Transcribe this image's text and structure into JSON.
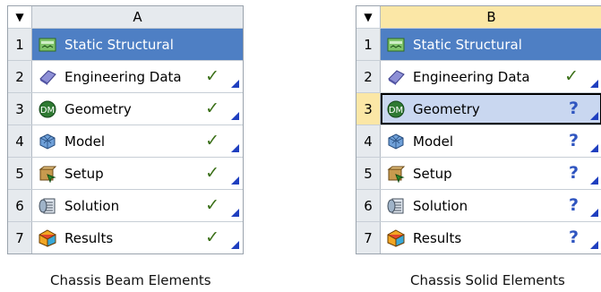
{
  "systems": [
    {
      "column": "A",
      "caption": "Chassis Beam Elements",
      "rows": [
        {
          "num": "1",
          "label": "Static Structural",
          "status": ""
        },
        {
          "num": "2",
          "label": "Engineering Data",
          "status": "✓"
        },
        {
          "num": "3",
          "label": "Geometry",
          "status": "✓"
        },
        {
          "num": "4",
          "label": "Model",
          "status": "✓"
        },
        {
          "num": "5",
          "label": "Setup",
          "status": "✓"
        },
        {
          "num": "6",
          "label": "Solution",
          "status": "✓"
        },
        {
          "num": "7",
          "label": "Results",
          "status": "✓"
        }
      ]
    },
    {
      "column": "B",
      "caption": "Chassis Solid Elements",
      "rows": [
        {
          "num": "1",
          "label": "Static Structural",
          "status": ""
        },
        {
          "num": "2",
          "label": "Engineering Data",
          "status": "✓"
        },
        {
          "num": "3",
          "label": "Geometry",
          "status": "?"
        },
        {
          "num": "4",
          "label": "Model",
          "status": "?"
        },
        {
          "num": "5",
          "label": "Setup",
          "status": "?"
        },
        {
          "num": "6",
          "label": "Solution",
          "status": "?"
        },
        {
          "num": "7",
          "label": "Results",
          "status": "?"
        }
      ]
    }
  ],
  "header_dropdown": "▼",
  "icons": [
    "static-structural-icon",
    "engineering-data-icon",
    "geometry-dm-icon",
    "model-mesh-icon",
    "setup-icon",
    "solution-icon",
    "results-icon"
  ],
  "colors": {
    "title_row": "#4e7fc4",
    "header_b": "#fbe7a6",
    "ok": "#3a6f17",
    "question": "#2f55c0",
    "selected_row": "#c9d7f0"
  }
}
